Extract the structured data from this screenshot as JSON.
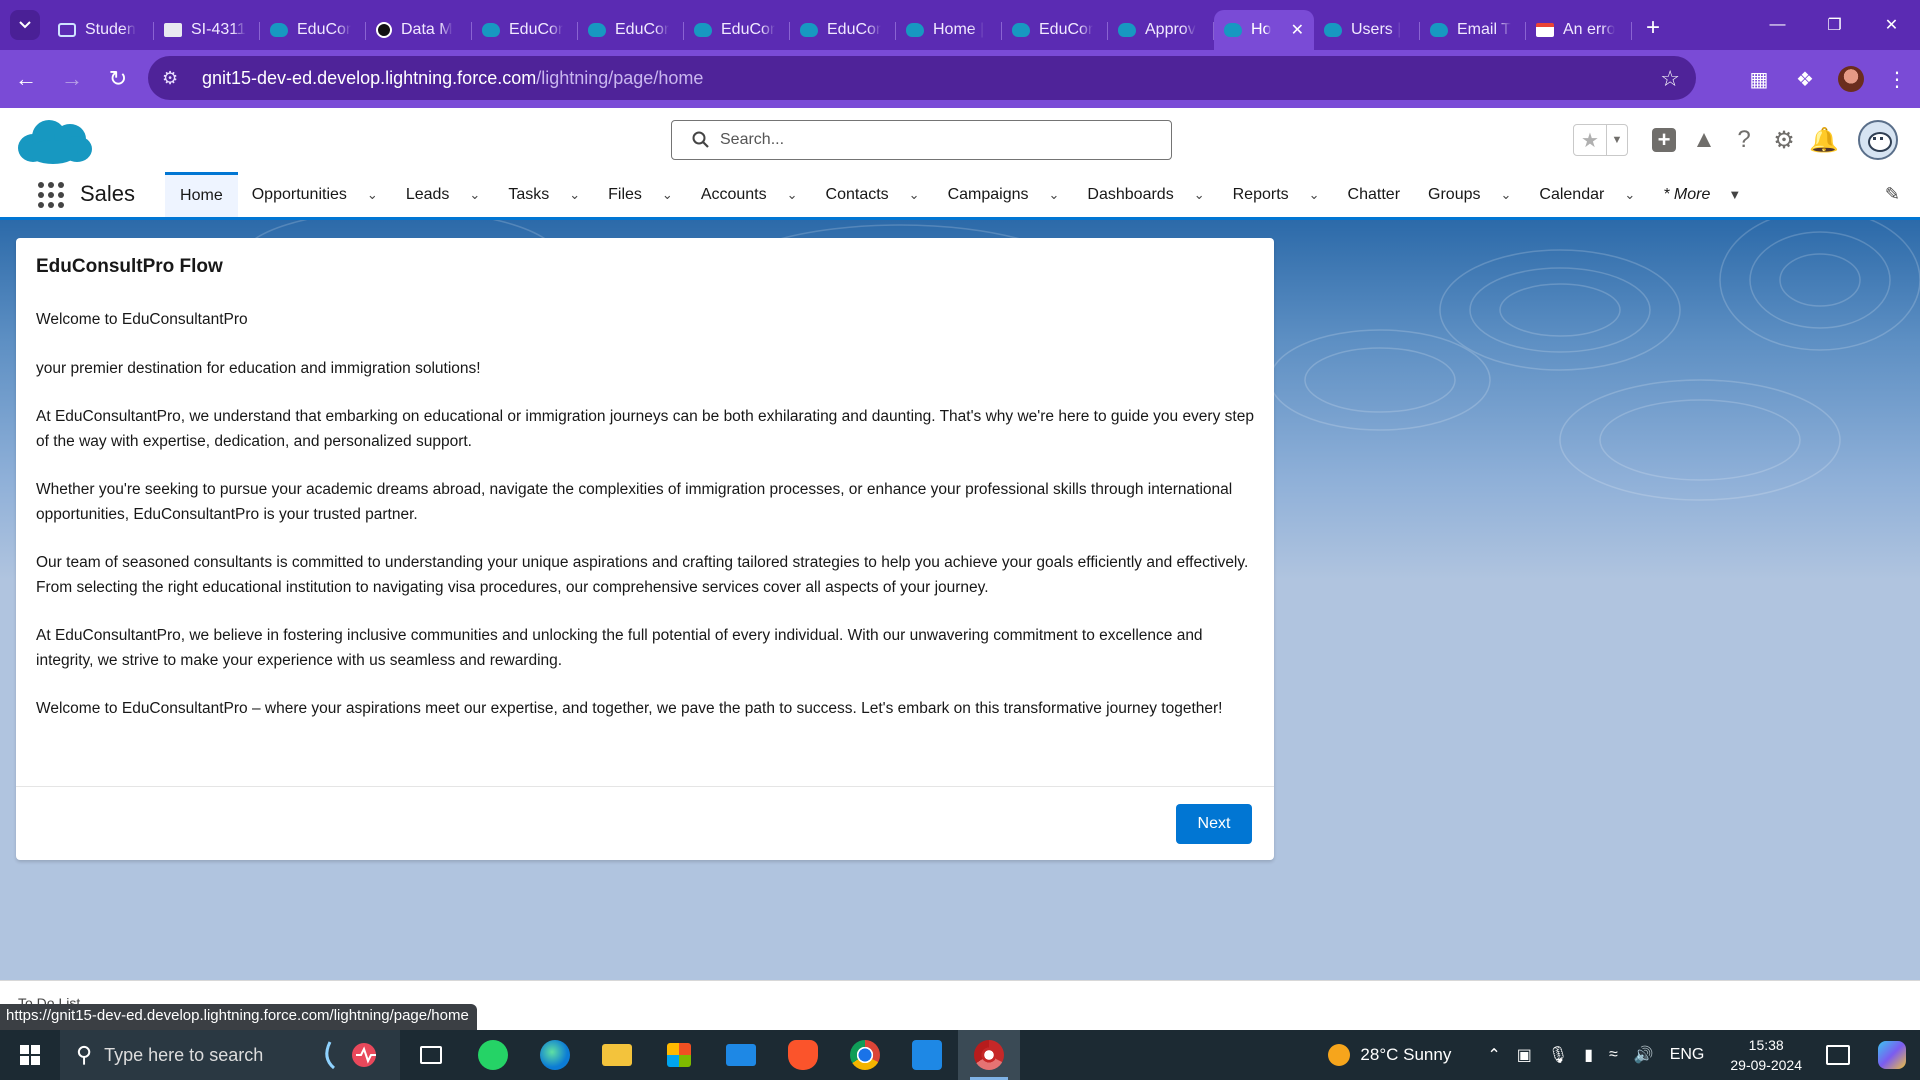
{
  "browser": {
    "tabs": [
      {
        "title": "Studen",
        "icon": "service-icon"
      },
      {
        "title": "SI-4311",
        "icon": "document-icon"
      },
      {
        "title": "EduCor",
        "icon": "salesforce-cloud-icon"
      },
      {
        "title": "Data M",
        "icon": "chatgpt-icon"
      },
      {
        "title": "EduCor",
        "icon": "salesforce-cloud-icon"
      },
      {
        "title": "EduCor",
        "icon": "salesforce-cloud-icon"
      },
      {
        "title": "EduCor",
        "icon": "salesforce-cloud-icon"
      },
      {
        "title": "EduCor",
        "icon": "salesforce-cloud-icon"
      },
      {
        "title": "Home |",
        "icon": "salesforce-cloud-icon"
      },
      {
        "title": "EduCor",
        "icon": "salesforce-cloud-icon"
      },
      {
        "title": "Approv",
        "icon": "salesforce-cloud-icon"
      },
      {
        "title": "Ho",
        "icon": "salesforce-cloud-icon",
        "active": true
      },
      {
        "title": "Users |",
        "icon": "salesforce-cloud-icon"
      },
      {
        "title": "Email T",
        "icon": "salesforce-cloud-icon"
      },
      {
        "title": "An erro",
        "icon": "gmail-icon"
      }
    ],
    "url_host": "gnit15-dev-ed.develop.lightning.force.com",
    "url_path": "/lightning/page/home",
    "status_url": "https://gnit15-dev-ed.develop.lightning.force.com/lightning/page/home",
    "accent": "#7a4bd6"
  },
  "header": {
    "search_placeholder": "Search..."
  },
  "nav": {
    "app_name": "Sales",
    "items": [
      {
        "label": "Home",
        "active": true,
        "has_menu": false
      },
      {
        "label": "Opportunities",
        "has_menu": true
      },
      {
        "label": "Leads",
        "has_menu": true
      },
      {
        "label": "Tasks",
        "has_menu": true
      },
      {
        "label": "Files",
        "has_menu": true
      },
      {
        "label": "Accounts",
        "has_menu": true
      },
      {
        "label": "Contacts",
        "has_menu": true
      },
      {
        "label": "Campaigns",
        "has_menu": true
      },
      {
        "label": "Dashboards",
        "has_menu": true
      },
      {
        "label": "Reports",
        "has_menu": true
      },
      {
        "label": "Chatter",
        "has_menu": false
      },
      {
        "label": "Groups",
        "has_menu": true
      },
      {
        "label": "Calendar",
        "has_menu": true
      }
    ],
    "more_label": "* More"
  },
  "flow": {
    "title": "EduConsultPro Flow",
    "paragraphs": [
      "Welcome to EduConsultantPro",
      "your premier destination for education and immigration solutions!",
      "At EduConsultantPro, we understand that embarking on educational or immigration journeys can be both exhilarating and daunting. That's why we're here to guide you every step of the way with expertise, dedication, and personalized support.",
      "Whether you're seeking to pursue your academic dreams abroad, navigate the complexities of immigration processes, or enhance your professional skills through international opportunities, EduConsultantPro is your trusted partner.",
      "Our team of seasoned consultants is committed to understanding your unique aspirations and crafting tailored strategies to help you achieve your goals efficiently and effectively. From selecting the right educational institution to navigating visa procedures, our comprehensive services cover all aspects of your journey.",
      "At EduConsultantPro, we believe in fostering inclusive communities and unlocking the full potential of every individual. With our unwavering commitment to excellence and integrity, we strive to make your experience with us seamless and rewarding.",
      "Welcome to EduConsultantPro – where your aspirations meet our expertise, and together, we pave the path to success. Let's embark on this transformative journey together!"
    ],
    "next_label": "Next",
    "button_color": "#0176d3"
  },
  "utility": {
    "todo_label": "To Do List"
  },
  "taskbar": {
    "search_placeholder": "Type here to search",
    "weather": "28°C  Sunny",
    "language": "ENG",
    "time": "15:38",
    "date": "29-09-2024"
  }
}
